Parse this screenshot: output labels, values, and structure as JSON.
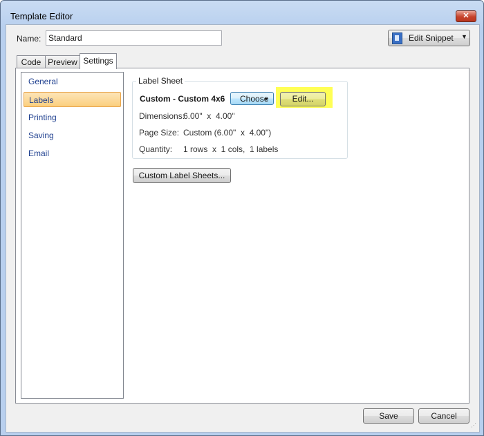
{
  "window": {
    "title": "Template Editor",
    "close_label": "✕"
  },
  "name_field": {
    "label": "Name:",
    "value": "Standard"
  },
  "snippet_button": {
    "label": "Edit Snippet",
    "arrow": "▼",
    "icon": "snippet-icon"
  },
  "tabs": [
    {
      "label": "Code"
    },
    {
      "label": "Preview"
    },
    {
      "label": "Settings"
    }
  ],
  "sidebar": {
    "items": [
      {
        "label": "General"
      },
      {
        "label": "Labels"
      },
      {
        "label": "Printing"
      },
      {
        "label": "Saving"
      },
      {
        "label": "Email"
      }
    ],
    "selected": "Labels"
  },
  "label_sheet": {
    "group_title": "Label Sheet",
    "name": "Custom - Custom 4x6",
    "choose_label": "Choose",
    "choose_arrow": "▾",
    "edit_label": "Edit...",
    "dimensions_label": "Dimensions:",
    "dimensions_value": "6.00\"  x  4.00\"",
    "page_size_label": "Page Size:",
    "page_size_value": "Custom (6.00\"  x  4.00\")",
    "quantity_label": "Quantity:",
    "quantity_value": "1 rows  x  1 cols,  1 labels"
  },
  "custom_sheets_button": {
    "label": "Custom Label Sheets..."
  },
  "footer": {
    "save_label": "Save",
    "cancel_label": "Cancel"
  },
  "colors": {
    "highlight": "#ffff55",
    "selected_item": "#fbcf7e"
  }
}
